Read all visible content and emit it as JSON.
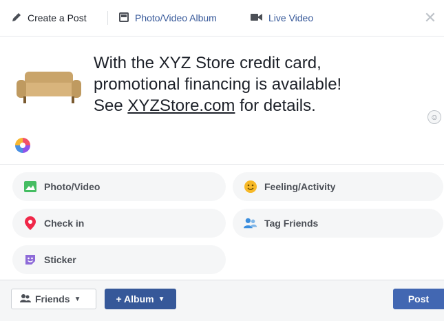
{
  "header": {
    "tabs": [
      {
        "label": "Create a Post",
        "icon": "pencil-icon"
      },
      {
        "label": "Photo/Video Album",
        "icon": "album-icon"
      },
      {
        "label": "Live Video",
        "icon": "video-camera-icon"
      }
    ],
    "close_icon": "close-icon"
  },
  "composer": {
    "image": "sofa-image",
    "text": {
      "line1": "With the XYZ Store credit card,",
      "line2": "promotional financing is available!",
      "line3_prefix": "See ",
      "line3_link": "XYZStore.com",
      "line3_suffix": " for details."
    },
    "emoji_icon": "emoji-icon",
    "avatar_icon": "color-wheel-icon"
  },
  "actions": [
    {
      "label": "Photo/Video",
      "icon": "photo-icon",
      "color": "#45bd62"
    },
    {
      "label": "Feeling/Activity",
      "icon": "smiley-icon",
      "color": "#f7b928"
    },
    {
      "label": "Check in",
      "icon": "location-pin-icon",
      "color": "#f02849"
    },
    {
      "label": "Tag Friends",
      "icon": "tag-friends-icon",
      "color": "#1877f2"
    },
    {
      "label": "Sticker",
      "icon": "sticker-icon",
      "color": "#8e6bd8"
    }
  ],
  "footer": {
    "audience_label": "Friends",
    "album_label": "+ Album",
    "post_label": "Post"
  },
  "colors": {
    "accent": "#4267b2",
    "link": "#365899",
    "pill_bg": "#f5f6f7"
  }
}
